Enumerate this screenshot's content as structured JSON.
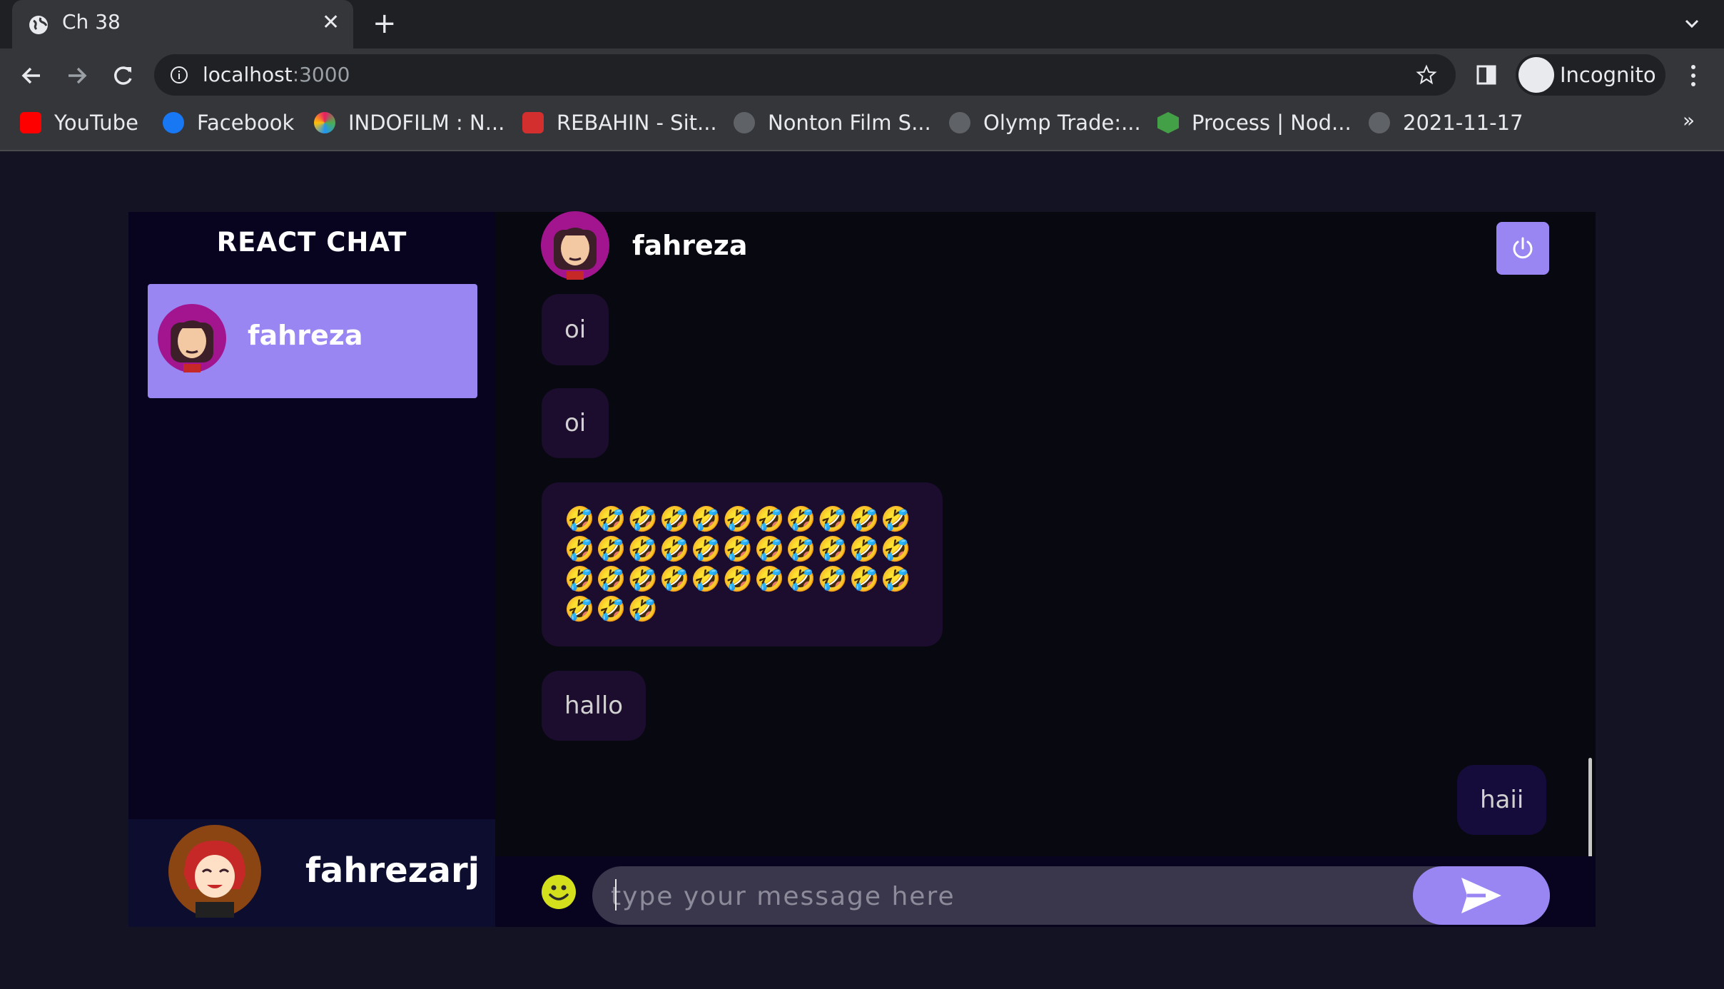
{
  "browser": {
    "tab_title": "Ch 38",
    "url_host": "localhost",
    "url_port": ":3000",
    "profile_label": "Incognito",
    "bookmarks": [
      {
        "label": "YouTube",
        "icon": "youtube-icon"
      },
      {
        "label": "Facebook",
        "icon": "facebook-icon"
      },
      {
        "label": "INDOFILM : N...",
        "icon": "indofilm-icon"
      },
      {
        "label": "REBAHIN - Sit...",
        "icon": "rebahin-icon"
      },
      {
        "label": "Nonton Film S...",
        "icon": "globe-icon"
      },
      {
        "label": "Olymp Trade:...",
        "icon": "globe-icon"
      },
      {
        "label": "Process | Nod...",
        "icon": "nodejs-icon"
      },
      {
        "label": "2021-11-17",
        "icon": "globe-icon"
      }
    ],
    "more_bookmarks": "»"
  },
  "app": {
    "brand": "REACT CHAT",
    "contacts": [
      {
        "name": "fahreza",
        "selected": true
      }
    ],
    "current_user": {
      "name": "fahrezarj"
    },
    "chat": {
      "contact_name": "fahreza",
      "messages": [
        {
          "text": "oi",
          "direction": "received"
        },
        {
          "text": "oi",
          "direction": "received"
        },
        {
          "text": "🤣🤣🤣🤣🤣🤣🤣🤣🤣🤣🤣🤣🤣🤣🤣🤣🤣🤣🤣🤣🤣🤣🤣🤣🤣🤣🤣🤣🤣🤣🤣🤣🤣🤣🤣🤣",
          "direction": "received"
        },
        {
          "text": "hallo",
          "direction": "received"
        },
        {
          "text": "haii",
          "direction": "sent"
        }
      ],
      "input_placeholder": "type your message here",
      "input_value": ""
    },
    "colors": {
      "accent": "#9a86f3",
      "background": "#131324",
      "sidebar": "#080420"
    }
  }
}
